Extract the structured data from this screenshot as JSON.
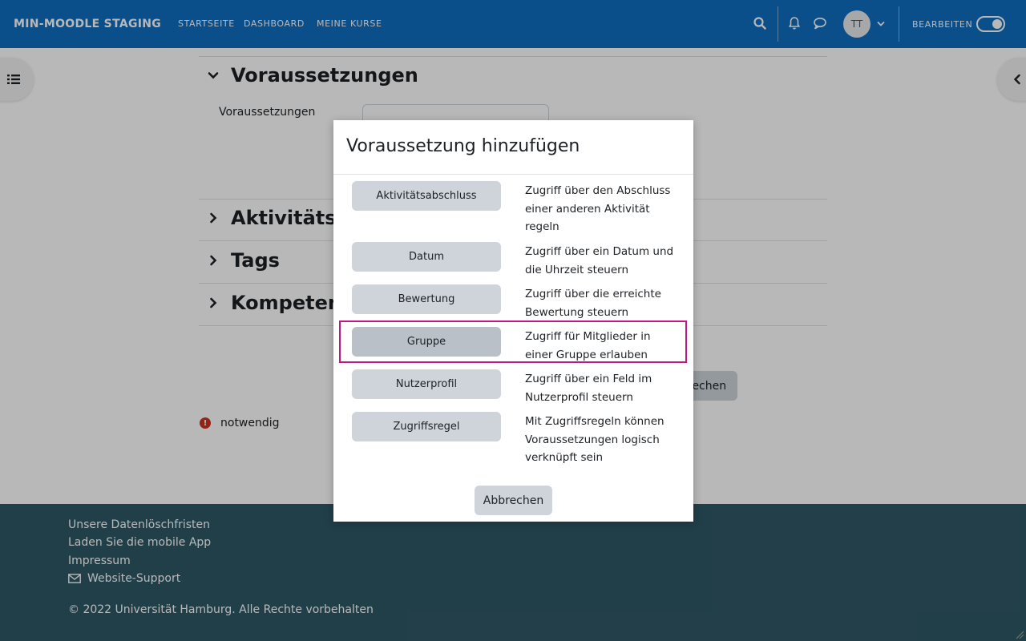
{
  "navbar": {
    "brand": "MIN-MOODLE STAGING",
    "links": [
      "STARTSEITE",
      "DASHBOARD",
      "MEINE KURSE"
    ],
    "avatar_initials": "TT",
    "edit_label": "BEARBEITEN",
    "edit_mode_on": true
  },
  "page": {
    "sections": [
      {
        "title": "Voraussetzungen",
        "expanded": true
      },
      {
        "title": "Aktivitätsa",
        "expanded": false
      },
      {
        "title": "Tags",
        "expanded": false
      },
      {
        "title": "Kompetenz",
        "expanded": false
      }
    ],
    "field_label": "Voraussetzungen",
    "cancel_partial": "rechen",
    "required_text": "notwendig"
  },
  "modal": {
    "title": "Voraussetzung hinzufügen",
    "options": [
      {
        "label": "Aktivitätsabschluss",
        "description": "Zugriff über den Abschluss einer anderen Aktivität regeln"
      },
      {
        "label": "Datum",
        "description": "Zugriff über ein Datum und die Uhrzeit steuern"
      },
      {
        "label": "Bewertung",
        "description": "Zugriff über die erreichte Bewertung steuern"
      },
      {
        "label": "Gruppe",
        "description": "Zugriff für Mitglieder in einer Gruppe erlauben"
      },
      {
        "label": "Nutzerprofil",
        "description": "Zugriff über ein Feld im Nutzerprofil steuern"
      },
      {
        "label": "Zugriffsregel",
        "description": "Mit Zugriffsregeln können Voraussetzungen logisch verknüpft sein"
      }
    ],
    "cancel_label": "Abbrechen"
  },
  "footer": {
    "links": [
      "Unsere Datenlöschfristen",
      "Laden Sie die mobile App",
      "Impressum"
    ],
    "support_label": "Website-Support",
    "copyright": "© 2022 Universität Hamburg. Alle Rechte vorbehalten"
  },
  "colors": {
    "navbar": "#0f6cbf",
    "footer": "#2f5866",
    "highlight": "#c2187e",
    "required": "#ca3120"
  }
}
